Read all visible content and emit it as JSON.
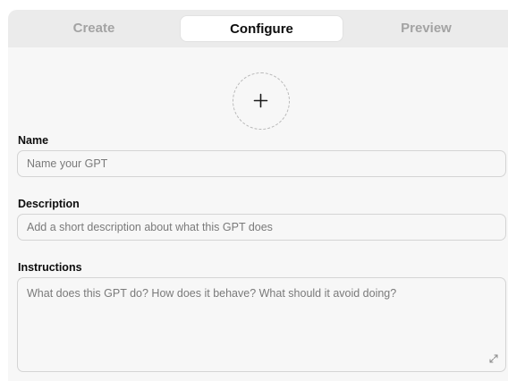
{
  "tabs": [
    {
      "label": "Create",
      "active": false
    },
    {
      "label": "Configure",
      "active": true
    },
    {
      "label": "Preview",
      "active": false
    }
  ],
  "avatar": {
    "icon": "plus-icon"
  },
  "fields": {
    "name": {
      "label": "Name",
      "placeholder": "Name your GPT",
      "value": ""
    },
    "description": {
      "label": "Description",
      "placeholder": "Add a short description about what this GPT does",
      "value": ""
    },
    "instructions": {
      "label": "Instructions",
      "placeholder": "What does this GPT do? How does it behave? What should it avoid doing?",
      "value": ""
    }
  },
  "icons": {
    "resize": "expand-icon"
  },
  "colors": {
    "panel": "#f7f7f7",
    "tabbar": "#ebebeb",
    "active_tab": "#ffffff",
    "inactive_tab_text": "#a3a3a3",
    "border": "#d4d4d4"
  }
}
